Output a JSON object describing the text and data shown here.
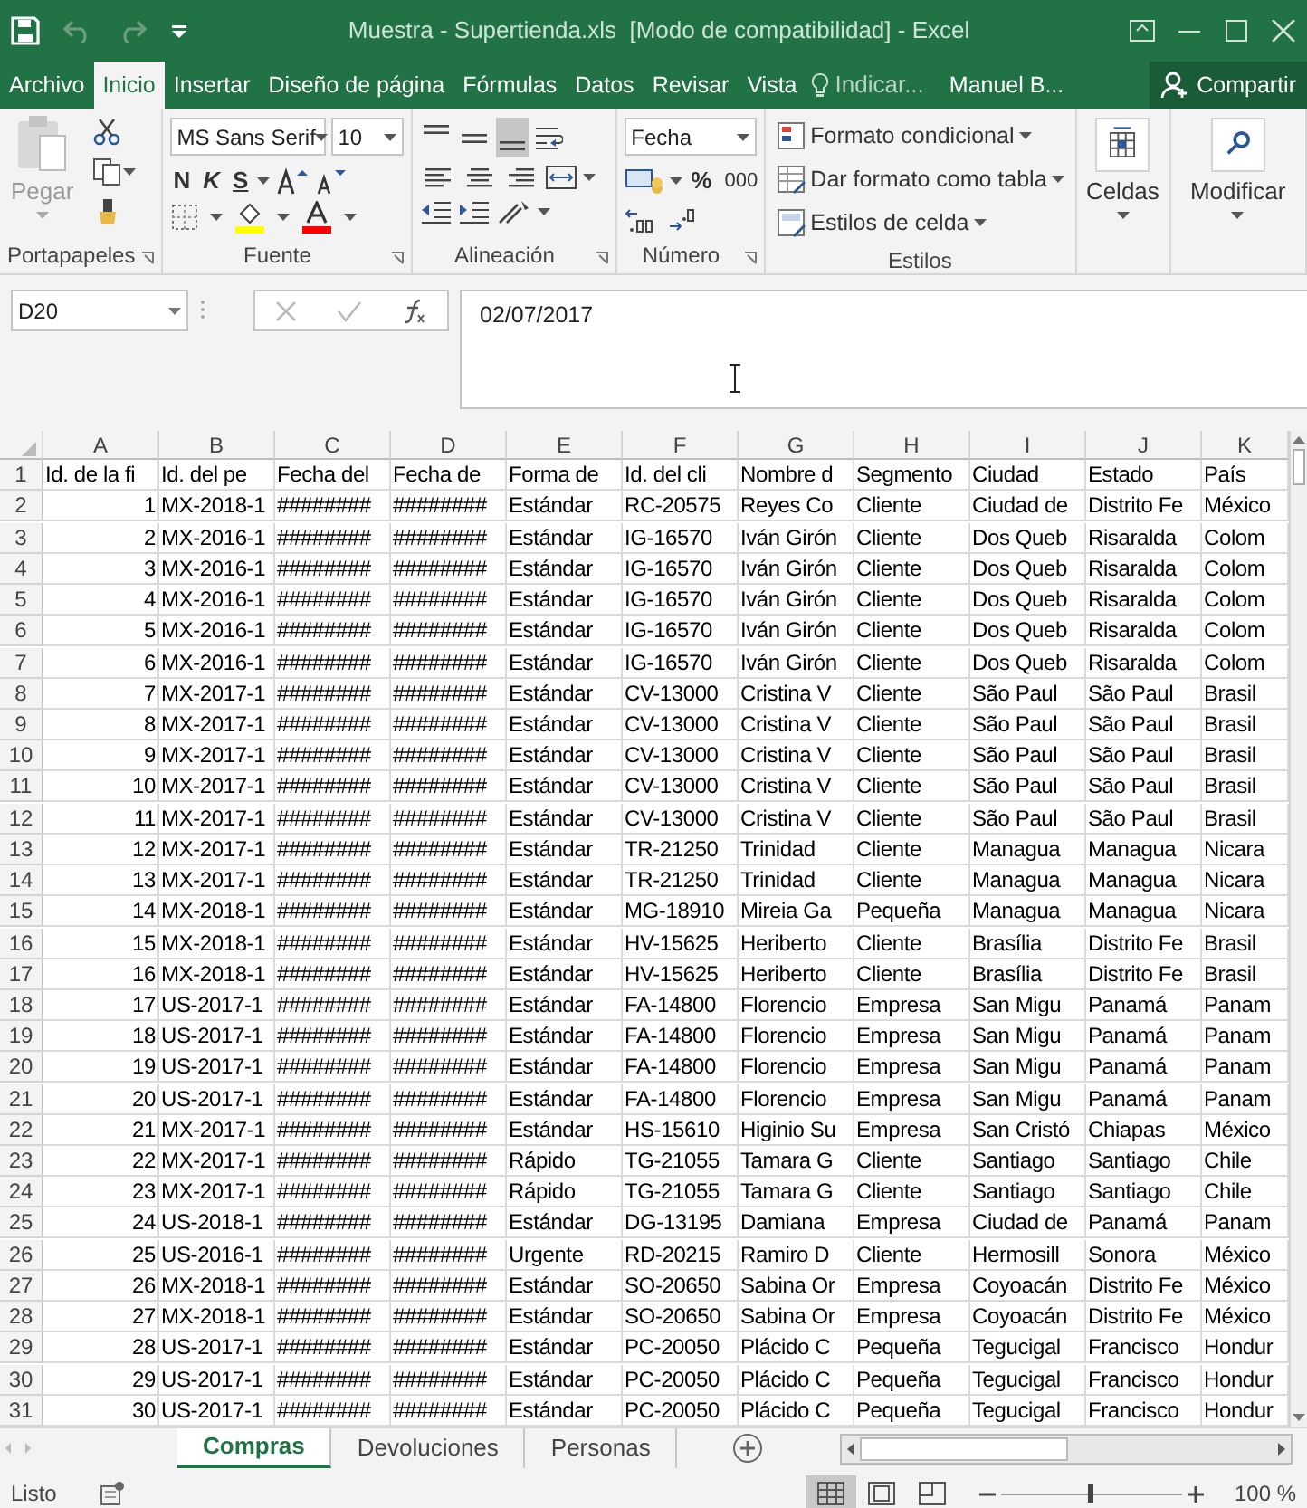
{
  "window": {
    "title": "Muestra - Supertienda.xls  [Modo de compatibilidad] - Excel"
  },
  "ribbon_tabs": [
    {
      "label": "Archivo",
      "selected": false
    },
    {
      "label": "Inicio",
      "selected": true
    },
    {
      "label": "Insertar",
      "selected": false
    },
    {
      "label": "Diseño de página",
      "selected": false
    },
    {
      "label": "Fórmulas",
      "selected": false
    },
    {
      "label": "Datos",
      "selected": false
    },
    {
      "label": "Revisar",
      "selected": false
    },
    {
      "label": "Vista",
      "selected": false
    }
  ],
  "tell_me": "Indicar...",
  "user": "Manuel B...",
  "share_button": "Compartir",
  "ribbon": {
    "clipboard": {
      "label": "Portapapeles",
      "paste": "Pegar"
    },
    "font": {
      "label": "Fuente",
      "family": "MS Sans Serif",
      "size": "10",
      "bold": "N",
      "italic": "K",
      "underline": "S"
    },
    "alignment": {
      "label": "Alineación",
      "vertical": [
        {
          "selected": false
        },
        {
          "selected": false
        },
        {
          "selected": true
        }
      ]
    },
    "number": {
      "label": "Número",
      "format": "Fecha",
      "percent": "%",
      "thousands": "000"
    },
    "styles": {
      "label": "Estilos",
      "items": [
        "Formato condicional",
        "Dar formato como tabla",
        "Estilos de celda"
      ]
    },
    "cells": "Celdas",
    "editing": "Modificar"
  },
  "formula_bar": {
    "name_box": "D20",
    "value": "02/07/2017"
  },
  "sheet": {
    "columns": [
      {
        "label": "A",
        "kind": "number"
      },
      {
        "label": "B",
        "kind": "text"
      },
      {
        "label": "C",
        "kind": "text"
      },
      {
        "label": "D",
        "kind": "text"
      },
      {
        "label": "E",
        "kind": "text"
      },
      {
        "label": "F",
        "kind": "text"
      },
      {
        "label": "G",
        "kind": "text"
      },
      {
        "label": "H",
        "kind": "text"
      },
      {
        "label": "I",
        "kind": "text"
      },
      {
        "label": "J",
        "kind": "text"
      },
      {
        "label": "K",
        "kind": "text"
      }
    ],
    "rows": [
      {
        "number": "1",
        "kind": "header",
        "cells": [
          "Id. de la fi",
          "Id. del pe",
          "Fecha del",
          "Fecha de",
          "Forma de",
          "Id. del cli",
          "Nombre d",
          "Segmento",
          "Ciudad",
          "Estado",
          "País"
        ]
      },
      {
        "number": "2",
        "kind": "data",
        "cells": [
          "1",
          "MX-2018-1",
          "########",
          "########",
          "Estándar",
          "RC-20575",
          "Reyes Co",
          "Cliente",
          "Ciudad de",
          "Distrito Fe",
          "México"
        ]
      },
      {
        "number": "3",
        "kind": "data",
        "cells": [
          "2",
          "MX-2016-1",
          "########",
          "########",
          "Estándar",
          "IG-16570",
          "Iván Girón",
          "Cliente",
          "Dos Queb",
          "Risaralda",
          "Colom"
        ]
      },
      {
        "number": "4",
        "kind": "data",
        "cells": [
          "3",
          "MX-2016-1",
          "########",
          "########",
          "Estándar",
          "IG-16570",
          "Iván Girón",
          "Cliente",
          "Dos Queb",
          "Risaralda",
          "Colom"
        ]
      },
      {
        "number": "5",
        "kind": "data",
        "cells": [
          "4",
          "MX-2016-1",
          "########",
          "########",
          "Estándar",
          "IG-16570",
          "Iván Girón",
          "Cliente",
          "Dos Queb",
          "Risaralda",
          "Colom"
        ]
      },
      {
        "number": "6",
        "kind": "data",
        "cells": [
          "5",
          "MX-2016-1",
          "########",
          "########",
          "Estándar",
          "IG-16570",
          "Iván Girón",
          "Cliente",
          "Dos Queb",
          "Risaralda",
          "Colom"
        ]
      },
      {
        "number": "7",
        "kind": "data",
        "cells": [
          "6",
          "MX-2016-1",
          "########",
          "########",
          "Estándar",
          "IG-16570",
          "Iván Girón",
          "Cliente",
          "Dos Queb",
          "Risaralda",
          "Colom"
        ]
      },
      {
        "number": "8",
        "kind": "data",
        "cells": [
          "7",
          "MX-2017-1",
          "########",
          "########",
          "Estándar",
          "CV-13000",
          "Cristina V",
          "Cliente",
          "São Paul",
          "São Paul",
          "Brasil"
        ]
      },
      {
        "number": "9",
        "kind": "data",
        "cells": [
          "8",
          "MX-2017-1",
          "########",
          "########",
          "Estándar",
          "CV-13000",
          "Cristina V",
          "Cliente",
          "São Paul",
          "São Paul",
          "Brasil"
        ]
      },
      {
        "number": "10",
        "kind": "data",
        "cells": [
          "9",
          "MX-2017-1",
          "########",
          "########",
          "Estándar",
          "CV-13000",
          "Cristina V",
          "Cliente",
          "São Paul",
          "São Paul",
          "Brasil"
        ]
      },
      {
        "number": "11",
        "kind": "data",
        "cells": [
          "10",
          "MX-2017-1",
          "########",
          "########",
          "Estándar",
          "CV-13000",
          "Cristina V",
          "Cliente",
          "São Paul",
          "São Paul",
          "Brasil"
        ]
      },
      {
        "number": "12",
        "kind": "data",
        "cells": [
          "11",
          "MX-2017-1",
          "########",
          "########",
          "Estándar",
          "CV-13000",
          "Cristina V",
          "Cliente",
          "São Paul",
          "São Paul",
          "Brasil"
        ]
      },
      {
        "number": "13",
        "kind": "data",
        "cells": [
          "12",
          "MX-2017-1",
          "########",
          "########",
          "Estándar",
          "TR-21250",
          "Trinidad",
          "Cliente",
          "Managua",
          "Managua",
          "Nicara"
        ]
      },
      {
        "number": "14",
        "kind": "data",
        "cells": [
          "13",
          "MX-2017-1",
          "########",
          "########",
          "Estándar",
          "TR-21250",
          "Trinidad",
          "Cliente",
          "Managua",
          "Managua",
          "Nicara"
        ]
      },
      {
        "number": "15",
        "kind": "data",
        "cells": [
          "14",
          "MX-2018-1",
          "########",
          "########",
          "Estándar",
          "MG-18910",
          "Mireia Ga",
          "Pequeña",
          "Managua",
          "Managua",
          "Nicara"
        ]
      },
      {
        "number": "16",
        "kind": "data",
        "cells": [
          "15",
          "MX-2018-1",
          "########",
          "########",
          "Estándar",
          "HV-15625",
          "Heriberto",
          "Cliente",
          "Brasília",
          "Distrito Fe",
          "Brasil"
        ]
      },
      {
        "number": "17",
        "kind": "data",
        "cells": [
          "16",
          "MX-2018-1",
          "########",
          "########",
          "Estándar",
          "HV-15625",
          "Heriberto",
          "Cliente",
          "Brasília",
          "Distrito Fe",
          "Brasil"
        ]
      },
      {
        "number": "18",
        "kind": "data",
        "cells": [
          "17",
          "US-2017-1",
          "########",
          "########",
          "Estándar",
          "FA-14800",
          "Florencio",
          "Empresa",
          "San Migu",
          "Panamá",
          "Panam"
        ]
      },
      {
        "number": "19",
        "kind": "data",
        "cells": [
          "18",
          "US-2017-1",
          "########",
          "########",
          "Estándar",
          "FA-14800",
          "Florencio",
          "Empresa",
          "San Migu",
          "Panamá",
          "Panam"
        ]
      },
      {
        "number": "20",
        "kind": "data",
        "cells": [
          "19",
          "US-2017-1",
          "########",
          "########",
          "Estándar",
          "FA-14800",
          "Florencio",
          "Empresa",
          "San Migu",
          "Panamá",
          "Panam"
        ]
      },
      {
        "number": "21",
        "kind": "data",
        "cells": [
          "20",
          "US-2017-1",
          "########",
          "########",
          "Estándar",
          "FA-14800",
          "Florencio",
          "Empresa",
          "San Migu",
          "Panamá",
          "Panam"
        ]
      },
      {
        "number": "22",
        "kind": "data",
        "cells": [
          "21",
          "MX-2017-1",
          "########",
          "########",
          "Estándar",
          "HS-15610",
          "Higinio Su",
          "Empresa",
          "San Cristó",
          "Chiapas",
          "México"
        ]
      },
      {
        "number": "23",
        "kind": "data",
        "cells": [
          "22",
          "MX-2017-1",
          "########",
          "########",
          "Rápido",
          "TG-21055",
          "Tamara G",
          "Cliente",
          "Santiago",
          "Santiago",
          "Chile"
        ]
      },
      {
        "number": "24",
        "kind": "data",
        "cells": [
          "23",
          "MX-2017-1",
          "########",
          "########",
          "Rápido",
          "TG-21055",
          "Tamara G",
          "Cliente",
          "Santiago",
          "Santiago",
          "Chile"
        ]
      },
      {
        "number": "25",
        "kind": "data",
        "cells": [
          "24",
          "US-2018-1",
          "########",
          "########",
          "Estándar",
          "DG-13195",
          "Damiana",
          "Empresa",
          "Ciudad de",
          "Panamá",
          "Panam"
        ]
      },
      {
        "number": "26",
        "kind": "data",
        "cells": [
          "25",
          "US-2016-1",
          "########",
          "########",
          "Urgente",
          "RD-20215",
          "Ramiro D",
          "Cliente",
          "Hermosill",
          "Sonora",
          "México"
        ]
      },
      {
        "number": "27",
        "kind": "data",
        "cells": [
          "26",
          "MX-2018-1",
          "########",
          "########",
          "Estándar",
          "SO-20650",
          "Sabina Or",
          "Empresa",
          "Coyoacán",
          "Distrito Fe",
          "México"
        ]
      },
      {
        "number": "28",
        "kind": "data",
        "cells": [
          "27",
          "MX-2018-1",
          "########",
          "########",
          "Estándar",
          "SO-20650",
          "Sabina Or",
          "Empresa",
          "Coyoacán",
          "Distrito Fe",
          "México"
        ]
      },
      {
        "number": "29",
        "kind": "data",
        "cells": [
          "28",
          "US-2017-1",
          "########",
          "########",
          "Estándar",
          "PC-20050",
          "Plácido C",
          "Pequeña",
          "Tegucigal",
          "Francisco",
          "Hondur"
        ]
      },
      {
        "number": "30",
        "kind": "data",
        "cells": [
          "29",
          "US-2017-1",
          "########",
          "########",
          "Estándar",
          "PC-20050",
          "Plácido C",
          "Pequeña",
          "Tegucigal",
          "Francisco",
          "Hondur"
        ]
      },
      {
        "number": "31",
        "kind": "data",
        "cells": [
          "30",
          "US-2017-1",
          "########",
          "########",
          "Estándar",
          "PC-20050",
          "Plácido C",
          "Pequeña",
          "Tegucigal",
          "Francisco",
          "Hondur"
        ]
      }
    ]
  },
  "sheet_tabs": [
    {
      "label": "Compras",
      "selected": true
    },
    {
      "label": "Devoluciones",
      "selected": false
    },
    {
      "label": "Personas",
      "selected": false
    }
  ],
  "status_bar": {
    "status": "Listo",
    "views": [
      {
        "selected": true
      },
      {
        "selected": false
      },
      {
        "selected": false
      }
    ],
    "zoom": {
      "level": 0.5,
      "reading": "100 %"
    }
  }
}
